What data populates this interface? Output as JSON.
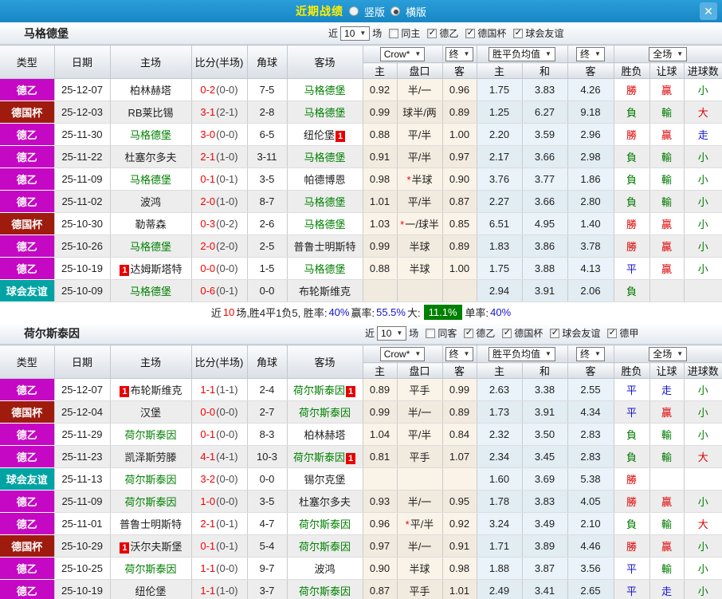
{
  "titlebar": {
    "title": "近期战绩",
    "vertical_label": "竖版",
    "horizontal_label": "横版",
    "horizontal_selected": true,
    "close_icon": "✕"
  },
  "icons": {
    "dropdown_arrow": "▼",
    "check": "✓",
    "star": "*"
  },
  "rank_badge": "1",
  "filter": {
    "recent_label": "近",
    "count": "10",
    "unit_label": "场"
  },
  "table_columns": {
    "type": "类型",
    "date": "日期",
    "home": "主场",
    "score_half": "比分(半场)",
    "corners": "角球",
    "away": "客场",
    "odds_home": "主",
    "handicap": "盘口",
    "odds_away": "客",
    "avg_home": "主",
    "avg_draw": "和",
    "avg_away": "客",
    "result": "胜负",
    "handicap_result": "让球",
    "goals": "进球数"
  },
  "dropdowns": {
    "bookmaker": "Crow*",
    "final": "终",
    "wdl_avg": "胜平负均值",
    "full_match": "全场"
  },
  "league_colors": {
    "德乙": "#c408c4",
    "德国杯": "#9e1b0e",
    "球会友谊": "#00a3a3",
    "德甲": "#c408c4"
  },
  "result_colors": {
    "勝": "#e00000",
    "贏": "#e00000",
    "大": "#e00000",
    "負": "#007a00",
    "輸": "#007a00",
    "小": "#007a00",
    "平": "#1414d2",
    "走": "#1414d2"
  },
  "sections": [
    {
      "team": "马格德堡",
      "focus_team": "马格德堡",
      "same_filter_label": "同主",
      "league_filters": [
        "德乙",
        "德国杯",
        "球会友谊"
      ],
      "rows": [
        {
          "league": "德乙",
          "date": "25-12-07",
          "home": "柏林赫塔",
          "home_badge": false,
          "score": "0-2",
          "half": "(0-0)",
          "corners": "7-5",
          "away": "马格德堡",
          "away_badge": false,
          "odds_home": "0.92",
          "handicap": "半/一",
          "handicap_star": false,
          "odds_away": "0.96",
          "avg_home": "1.75",
          "avg_draw": "3.83",
          "avg_away": "4.26",
          "result": "勝",
          "handicap_result": "贏",
          "goals_result": "小"
        },
        {
          "league": "德国杯",
          "date": "25-12-03",
          "home": "RB莱比锡",
          "home_badge": false,
          "score": "3-1",
          "half": "(2-1)",
          "corners": "2-8",
          "away": "马格德堡",
          "away_badge": false,
          "odds_home": "0.99",
          "handicap": "球半/两",
          "handicap_star": false,
          "odds_away": "0.89",
          "avg_home": "1.25",
          "avg_draw": "6.27",
          "avg_away": "9.18",
          "result": "負",
          "handicap_result": "輸",
          "goals_result": "大"
        },
        {
          "league": "德乙",
          "date": "25-11-30",
          "home": "马格德堡",
          "home_badge": false,
          "score": "3-0",
          "half": "(0-0)",
          "corners": "6-5",
          "away": "纽伦堡",
          "away_badge": true,
          "odds_home": "0.88",
          "handicap": "平/半",
          "handicap_star": false,
          "odds_away": "1.00",
          "avg_home": "2.20",
          "avg_draw": "3.59",
          "avg_away": "2.96",
          "result": "勝",
          "handicap_result": "贏",
          "goals_result": "走"
        },
        {
          "league": "德乙",
          "date": "25-11-22",
          "home": "杜塞尔多夫",
          "home_badge": false,
          "score": "2-1",
          "half": "(1-0)",
          "corners": "3-11",
          "away": "马格德堡",
          "away_badge": false,
          "odds_home": "0.91",
          "handicap": "平/半",
          "handicap_star": false,
          "odds_away": "0.97",
          "avg_home": "2.17",
          "avg_draw": "3.66",
          "avg_away": "2.98",
          "result": "負",
          "handicap_result": "輸",
          "goals_result": "小"
        },
        {
          "league": "德乙",
          "date": "25-11-09",
          "home": "马格德堡",
          "home_badge": false,
          "score": "0-1",
          "half": "(0-1)",
          "corners": "3-5",
          "away": "帕德博恩",
          "away_badge": false,
          "odds_home": "0.98",
          "handicap": "半球",
          "handicap_star": true,
          "odds_away": "0.90",
          "avg_home": "3.76",
          "avg_draw": "3.77",
          "avg_away": "1.86",
          "result": "負",
          "handicap_result": "輸",
          "goals_result": "小"
        },
        {
          "league": "德乙",
          "date": "25-11-02",
          "home": "波鸿",
          "home_badge": false,
          "score": "2-0",
          "half": "(1-0)",
          "corners": "8-7",
          "away": "马格德堡",
          "away_badge": false,
          "odds_home": "1.01",
          "handicap": "平/半",
          "handicap_star": false,
          "odds_away": "0.87",
          "avg_home": "2.27",
          "avg_draw": "3.66",
          "avg_away": "2.80",
          "result": "負",
          "handicap_result": "輸",
          "goals_result": "小"
        },
        {
          "league": "德国杯",
          "date": "25-10-30",
          "home": "勒蒂森",
          "home_badge": false,
          "score": "0-3",
          "half": "(0-2)",
          "corners": "2-6",
          "away": "马格德堡",
          "away_badge": false,
          "odds_home": "1.03",
          "handicap": "一/球半",
          "handicap_star": true,
          "odds_away": "0.85",
          "avg_home": "6.51",
          "avg_draw": "4.95",
          "avg_away": "1.40",
          "result": "勝",
          "handicap_result": "贏",
          "goals_result": "小"
        },
        {
          "league": "德乙",
          "date": "25-10-26",
          "home": "马格德堡",
          "home_badge": false,
          "score": "2-0",
          "half": "(2-0)",
          "corners": "2-5",
          "away": "普鲁士明斯特",
          "away_badge": false,
          "odds_home": "0.99",
          "handicap": "半球",
          "handicap_star": false,
          "odds_away": "0.89",
          "avg_home": "1.83",
          "avg_draw": "3.86",
          "avg_away": "3.78",
          "result": "勝",
          "handicap_result": "贏",
          "goals_result": "小"
        },
        {
          "league": "德乙",
          "date": "25-10-19",
          "home": "达姆斯塔特",
          "home_badge": true,
          "score": "0-0",
          "half": "(0-0)",
          "corners": "1-5",
          "away": "马格德堡",
          "away_badge": false,
          "odds_home": "0.88",
          "handicap": "半球",
          "handicap_star": false,
          "odds_away": "1.00",
          "avg_home": "1.75",
          "avg_draw": "3.88",
          "avg_away": "4.13",
          "result": "平",
          "handicap_result": "贏",
          "goals_result": "小"
        },
        {
          "league": "球会友谊",
          "date": "25-10-09",
          "home": "马格德堡",
          "home_badge": false,
          "score": "0-6",
          "half": "(0-1)",
          "corners": "0-0",
          "away": "布轮斯维克",
          "away_badge": false,
          "odds_home": "",
          "handicap": "",
          "handicap_star": false,
          "odds_away": "",
          "avg_home": "2.94",
          "avg_draw": "3.91",
          "avg_away": "2.06",
          "result": "負",
          "handicap_result": "",
          "goals_result": ""
        }
      ],
      "summary_parts": [
        {
          "text": "近"
        },
        {
          "text": "10",
          "color": "#ff0000"
        },
        {
          "text": "场,胜4平1负5, 胜率:"
        },
        {
          "text": "40%",
          "color": "#1414d2"
        },
        {
          "text": " 赢率:"
        },
        {
          "text": "55.5%",
          "color": "#1414d2"
        },
        {
          "text": " 大:"
        },
        {
          "text": "11.1%",
          "badge": true
        },
        {
          "text": " 单率:"
        },
        {
          "text": "40%",
          "color": "#1414d2"
        }
      ]
    },
    {
      "team": "荷尔斯泰因",
      "focus_team": "荷尔斯泰因",
      "same_filter_label": "同客",
      "league_filters": [
        "德乙",
        "德国杯",
        "球会友谊",
        "德甲"
      ],
      "rows": [
        {
          "league": "德乙",
          "date": "25-12-07",
          "home": "布轮斯维克",
          "home_badge": true,
          "score": "1-1",
          "half": "(1-1)",
          "corners": "2-4",
          "away": "荷尔斯泰因",
          "away_badge": true,
          "odds_home": "0.89",
          "handicap": "平手",
          "handicap_star": false,
          "odds_away": "0.99",
          "avg_home": "2.63",
          "avg_draw": "3.38",
          "avg_away": "2.55",
          "result": "平",
          "handicap_result": "走",
          "goals_result": "小"
        },
        {
          "league": "德国杯",
          "date": "25-12-04",
          "home": "汉堡",
          "home_badge": false,
          "score": "0-0",
          "half": "(0-0)",
          "corners": "2-7",
          "away": "荷尔斯泰因",
          "away_badge": false,
          "odds_home": "0.99",
          "handicap": "半/一",
          "handicap_star": false,
          "odds_away": "0.89",
          "avg_home": "1.73",
          "avg_draw": "3.91",
          "avg_away": "4.34",
          "result": "平",
          "handicap_result": "贏",
          "goals_result": "小"
        },
        {
          "league": "德乙",
          "date": "25-11-29",
          "home": "荷尔斯泰因",
          "home_badge": false,
          "score": "0-1",
          "half": "(0-0)",
          "corners": "8-3",
          "away": "柏林赫塔",
          "away_badge": false,
          "odds_home": "1.04",
          "handicap": "平/半",
          "handicap_star": false,
          "odds_away": "0.84",
          "avg_home": "2.32",
          "avg_draw": "3.50",
          "avg_away": "2.83",
          "result": "負",
          "handicap_result": "輸",
          "goals_result": "小"
        },
        {
          "league": "德乙",
          "date": "25-11-23",
          "home": "凯泽斯劳滕",
          "home_badge": false,
          "score": "4-1",
          "half": "(4-1)",
          "corners": "10-3",
          "away": "荷尔斯泰因",
          "away_badge": true,
          "odds_home": "0.81",
          "handicap": "平手",
          "handicap_star": false,
          "odds_away": "1.07",
          "avg_home": "2.34",
          "avg_draw": "3.45",
          "avg_away": "2.83",
          "result": "負",
          "handicap_result": "輸",
          "goals_result": "大"
        },
        {
          "league": "球会友谊",
          "date": "25-11-13",
          "home": "荷尔斯泰因",
          "home_badge": false,
          "score": "3-2",
          "half": "(0-0)",
          "corners": "0-0",
          "away": "锡尔克堡",
          "away_badge": false,
          "odds_home": "",
          "handicap": "",
          "handicap_star": false,
          "odds_away": "",
          "avg_home": "1.60",
          "avg_draw": "3.69",
          "avg_away": "5.38",
          "result": "勝",
          "handicap_result": "",
          "goals_result": ""
        },
        {
          "league": "德乙",
          "date": "25-11-09",
          "home": "荷尔斯泰因",
          "home_badge": false,
          "score": "1-0",
          "half": "(0-0)",
          "corners": "3-5",
          "away": "杜塞尔多夫",
          "away_badge": false,
          "odds_home": "0.93",
          "handicap": "半/一",
          "handicap_star": false,
          "odds_away": "0.95",
          "avg_home": "1.78",
          "avg_draw": "3.83",
          "avg_away": "4.05",
          "result": "勝",
          "handicap_result": "贏",
          "goals_result": "小"
        },
        {
          "league": "德乙",
          "date": "25-11-01",
          "home": "普鲁士明斯特",
          "home_badge": false,
          "score": "2-1",
          "half": "(0-1)",
          "corners": "4-7",
          "away": "荷尔斯泰因",
          "away_badge": false,
          "odds_home": "0.96",
          "handicap": "平/半",
          "handicap_star": true,
          "odds_away": "0.92",
          "avg_home": "3.24",
          "avg_draw": "3.49",
          "avg_away": "2.10",
          "result": "負",
          "handicap_result": "輸",
          "goals_result": "大"
        },
        {
          "league": "德国杯",
          "date": "25-10-29",
          "home": "沃尔夫斯堡",
          "home_badge": true,
          "score": "0-1",
          "half": "(0-1)",
          "corners": "5-4",
          "away": "荷尔斯泰因",
          "away_badge": false,
          "odds_home": "0.97",
          "handicap": "半/一",
          "handicap_star": false,
          "odds_away": "0.91",
          "avg_home": "1.71",
          "avg_draw": "3.89",
          "avg_away": "4.46",
          "result": "勝",
          "handicap_result": "贏",
          "goals_result": "小"
        },
        {
          "league": "德乙",
          "date": "25-10-25",
          "home": "荷尔斯泰因",
          "home_badge": false,
          "score": "1-1",
          "half": "(0-0)",
          "corners": "9-7",
          "away": "波鸿",
          "away_badge": false,
          "odds_home": "0.90",
          "handicap": "半球",
          "handicap_star": false,
          "odds_away": "0.98",
          "avg_home": "1.88",
          "avg_draw": "3.87",
          "avg_away": "3.56",
          "result": "平",
          "handicap_result": "輸",
          "goals_result": "小"
        },
        {
          "league": "德乙",
          "date": "25-10-19",
          "home": "纽伦堡",
          "home_badge": false,
          "score": "1-1",
          "half": "(1-0)",
          "corners": "3-7",
          "away": "荷尔斯泰因",
          "away_badge": false,
          "odds_home": "0.87",
          "handicap": "平手",
          "handicap_star": false,
          "odds_away": "1.01",
          "avg_home": "2.49",
          "avg_draw": "3.41",
          "avg_away": "2.65",
          "result": "平",
          "handicap_result": "走",
          "goals_result": "小"
        }
      ]
    }
  ]
}
